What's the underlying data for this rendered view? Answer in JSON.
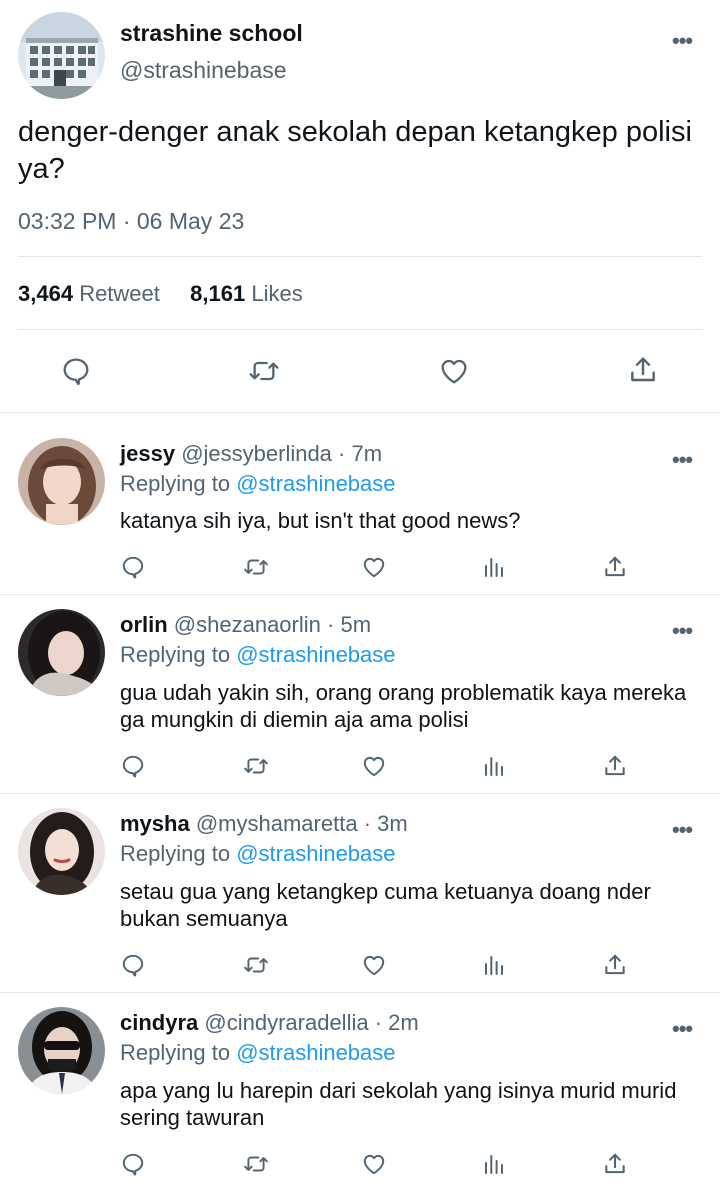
{
  "main_tweet": {
    "display_name": "strashine school",
    "handle": "@strashinebase",
    "text": "denger-denger anak sekolah depan ketangkep polisi ya?",
    "timestamp": "03:32 PM · 06 May 23",
    "retweet_count": "3,464",
    "retweet_label": "Retweet",
    "like_count": "8,161",
    "like_label": "Likes"
  },
  "replies": [
    {
      "name": "jessy",
      "handle": "@jessyberlinda",
      "time": "· 7m",
      "replying_prefix": "Replying to",
      "replying_to": "@strashinebase",
      "text": "katanya sih iya, but isn't that good news?"
    },
    {
      "name": "orlin",
      "handle": "@shezanaorlin",
      "time": "· 5m",
      "replying_prefix": "Replying to",
      "replying_to": "@strashinebase",
      "text": "gua udah yakin sih, orang  orang problematik kaya mereka ga mungkin di diemin aja ama polisi"
    },
    {
      "name": "mysha",
      "handle": "@myshamaretta",
      "time": "· 3m",
      "replying_prefix": "Replying to",
      "replying_to": "@strashinebase",
      "text": "setau gua yang ketangkep cuma ketuanya doang nder bukan semuanya"
    },
    {
      "name": "cindyra",
      "handle": "@cindyraradellia",
      "time": "· 2m",
      "replying_prefix": "Replying to",
      "replying_to": "@strashinebase",
      "text": "apa yang lu harepin dari sekolah yang isinya murid murid sering tawuran"
    }
  ],
  "icons": {
    "more": "more-dots-icon",
    "reply": "reply-bubble-icon",
    "retweet": "retweet-icon",
    "like": "heart-icon",
    "views": "bar-chart-icon",
    "share": "share-upload-icon"
  },
  "colors": {
    "text": "#0f1419",
    "secondary": "#536471",
    "mention": "#1d9bf0",
    "divider": "#e1e8ed"
  }
}
